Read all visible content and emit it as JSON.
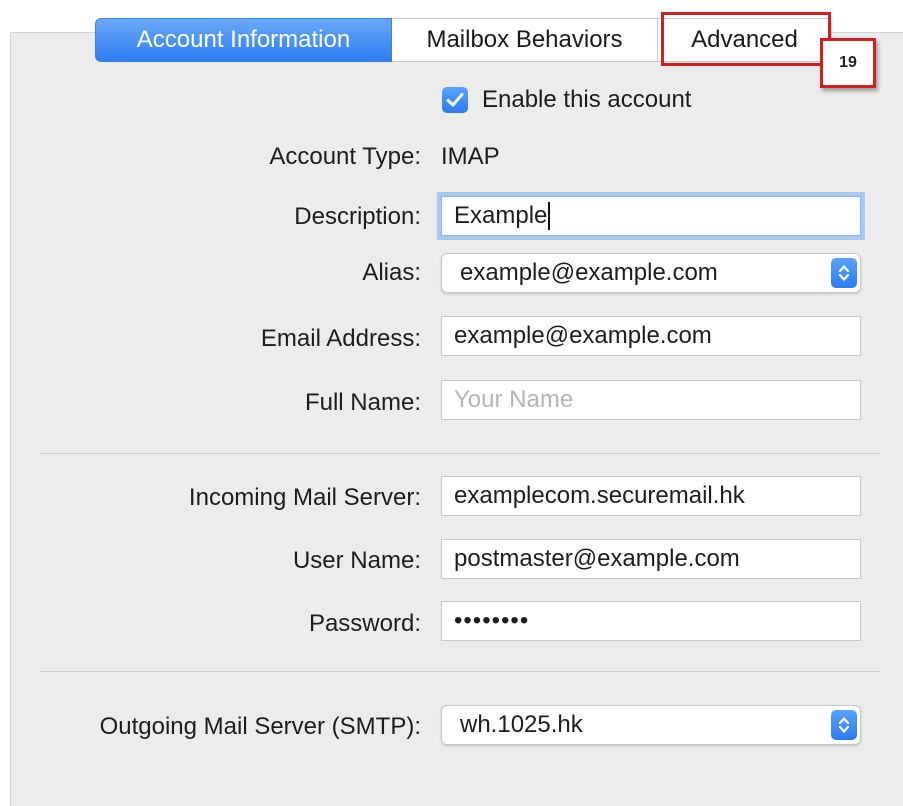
{
  "tabs": [
    {
      "label": "Account Information",
      "active": true
    },
    {
      "label": "Mailbox Behaviors",
      "active": false
    },
    {
      "label": "Advanced",
      "active": false
    }
  ],
  "annotation": {
    "badge": "19",
    "color": "#d21f1f"
  },
  "enable": {
    "label": "Enable this account",
    "checked": true
  },
  "account_type": {
    "label": "Account Type:",
    "value": "IMAP"
  },
  "description": {
    "label": "Description:",
    "value": "Example"
  },
  "alias": {
    "label": "Alias:",
    "value": "example@example.com"
  },
  "email": {
    "label": "Email Address:",
    "value": "example@example.com"
  },
  "full_name": {
    "label": "Full Name:",
    "value": "",
    "placeholder": "Your Name"
  },
  "incoming": {
    "label": "Incoming Mail Server:",
    "value": "examplecom.securemail.hk"
  },
  "username": {
    "label": "User Name:",
    "value": "postmaster@example.com"
  },
  "password": {
    "label": "Password:",
    "value": "••••••••"
  },
  "smtp": {
    "label": "Outgoing Mail Server (SMTP):",
    "value": "wh.1025.hk"
  },
  "colors": {
    "accent": "#2f7ef1",
    "panel": "#ececec"
  }
}
